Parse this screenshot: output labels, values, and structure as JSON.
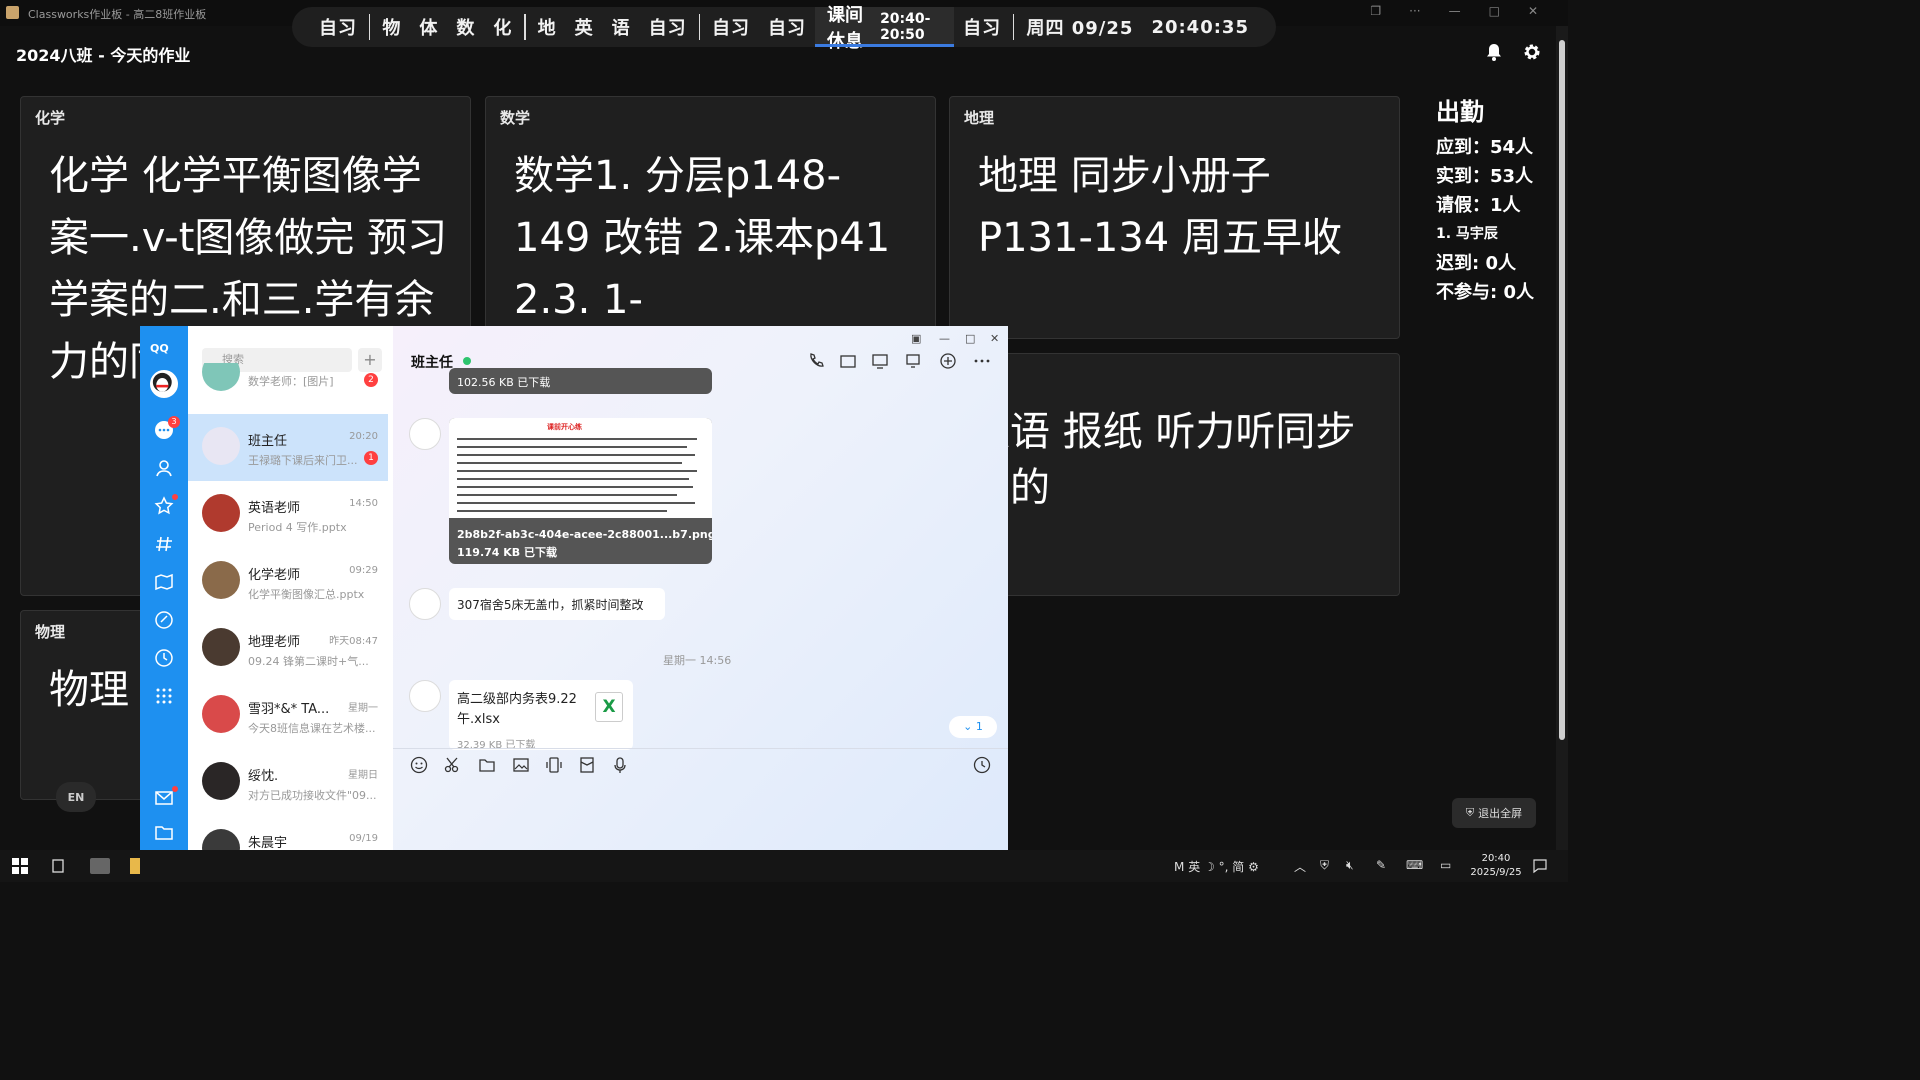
{
  "app": {
    "window_title": "Classworks作业板 - 高二8班作业板",
    "class_title": "2024八班 - 今天的作业"
  },
  "schedule": {
    "items_a": [
      "自习"
    ],
    "items_b": [
      "物",
      "体",
      "数",
      "化"
    ],
    "items_c": [
      "地",
      "英",
      "语",
      "自习"
    ],
    "items_d": [
      "自习",
      "自习"
    ],
    "current_label": "课间休息",
    "current_time": "20:40-20:50",
    "after_current": "自习",
    "date": "周四 09/25",
    "clock": "20:40:35"
  },
  "cards": {
    "chem": {
      "label": "化学",
      "text": "化学 化学平衡图像学案一.v-t图像做完 预习学案的二.和三.学有余力的同学可以做一下"
    },
    "math": {
      "label": "数学",
      "text": "数学1. 分层p148-149 改错 2.课本p41 2.3. 1-"
    },
    "geo": {
      "label": "地理",
      "text": "地理 同步小册子P131-134 周五早收"
    },
    "eng": {
      "label": "英语",
      "text": "英语 报纸 听力听同步上的"
    },
    "phys": {
      "label": "物理",
      "text": "物理"
    }
  },
  "attendance": {
    "title": "出勤",
    "should": "应到：54人",
    "actual": "实到：53人",
    "leave": "请假：1人",
    "leave_name": "1. 马宇辰",
    "late": "迟到: 0人",
    "absent": "不参与: 0人"
  },
  "exit_fullscreen": "退出全屏",
  "ime_badge": "EN",
  "qq": {
    "logo": "QQ",
    "search_placeholder": "搜索",
    "msg_badge": "3",
    "conversations": [
      {
        "name": "",
        "time": "",
        "msg": "数学老师：[图片]",
        "badge": "2"
      },
      {
        "name": "班主任",
        "time": "20:20",
        "msg": "王禄璐下课后来门卫...",
        "badge": "1"
      },
      {
        "name": "英语老师",
        "time": "14:50",
        "msg": "Period 4 写作.pptx",
        "badge": ""
      },
      {
        "name": "化学老师",
        "time": "09:29",
        "msg": "化学平衡图像汇总.pptx",
        "badge": ""
      },
      {
        "name": "地理老师",
        "time": "昨天08:47",
        "msg": "09.24 锋第二课时+气...",
        "badge": ""
      },
      {
        "name": "雪羽*&* TA...",
        "time": "星期一",
        "msg": "今天8班信息课在艺术楼...",
        "badge": ""
      },
      {
        "name": "绥忱.",
        "time": "星期日",
        "msg": "对方已成功接收文件\"09...",
        "badge": ""
      },
      {
        "name": "朱晨宇",
        "time": "09/19",
        "msg": "",
        "badge": ""
      }
    ],
    "chat": {
      "title": "班主任",
      "top_image_caption": "102.56 KB 已下载",
      "doc_title": "课前开心练",
      "image_filename": "2b8b2f-ab3c-404e-acee-2c88001...b7.png",
      "image_size": "119.74 KB 已下载",
      "text_msg": "307宿舍5床无盖巾，抓紧时间整改",
      "date_divider": "星期一 14:56",
      "file_name": "高二级部内务表9.22午.xlsx",
      "file_meta": "32.39 KB   已下载",
      "file_icon": "X",
      "jump_label": "1"
    }
  },
  "taskbar": {
    "tray_text": "英",
    "tray_simplified": "简",
    "clock_time": "20:40",
    "clock_date": "2025/9/25"
  }
}
